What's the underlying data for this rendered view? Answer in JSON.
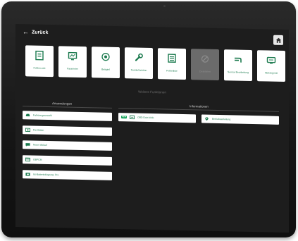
{
  "header": {
    "back_label": "Zurück",
    "home_icon": "home-icon"
  },
  "tiles": [
    {
      "label": "Fehlercode",
      "icon": "document-code-icon"
    },
    {
      "label": "Parameter",
      "icon": "monitor-icon"
    },
    {
      "label": "Beispiel",
      "icon": "target-icon"
    },
    {
      "label": "Sonderfunktion",
      "icon": "wrench-icon"
    },
    {
      "label": "Fehlerliste",
      "icon": "list-icon"
    },
    {
      "label": "Deaktiviert",
      "icon": "disabled-icon"
    },
    {
      "label": "Sensor Bearbeitung",
      "icon": "pipe-icon"
    },
    {
      "label": "Ablesegerät",
      "icon": "device-icon"
    }
  ],
  "more_functions_title": "Weitere Funktionen",
  "applications": {
    "heading": "Anwendungen",
    "items": [
      {
        "label": "Fahrzeugauswahl",
        "icon": "car-icon"
      },
      {
        "label": "Für Aktion",
        "icon": "photo-icon"
      },
      {
        "label": "Neuer Ablauf",
        "icon": "chat-icon"
      },
      {
        "label": "OBPCM",
        "icon": "card-icon"
      },
      {
        "label": "Ist-Batteriediagnose Pro",
        "icon": "battery-icon"
      }
    ]
  },
  "information": {
    "heading": "Informationen",
    "items": [
      {
        "label": "OBD Data Web",
        "badge": "NEW",
        "icon": "data-icon"
      },
      {
        "label": "Betriebsanleitung",
        "icon": "location-pin-icon"
      }
    ]
  },
  "colors": {
    "accent": "#1b7a4e",
    "screen_bg": "#1d1d1d",
    "tile_bg": "#ffffff",
    "disabled_bg": "#6b6b6b"
  }
}
